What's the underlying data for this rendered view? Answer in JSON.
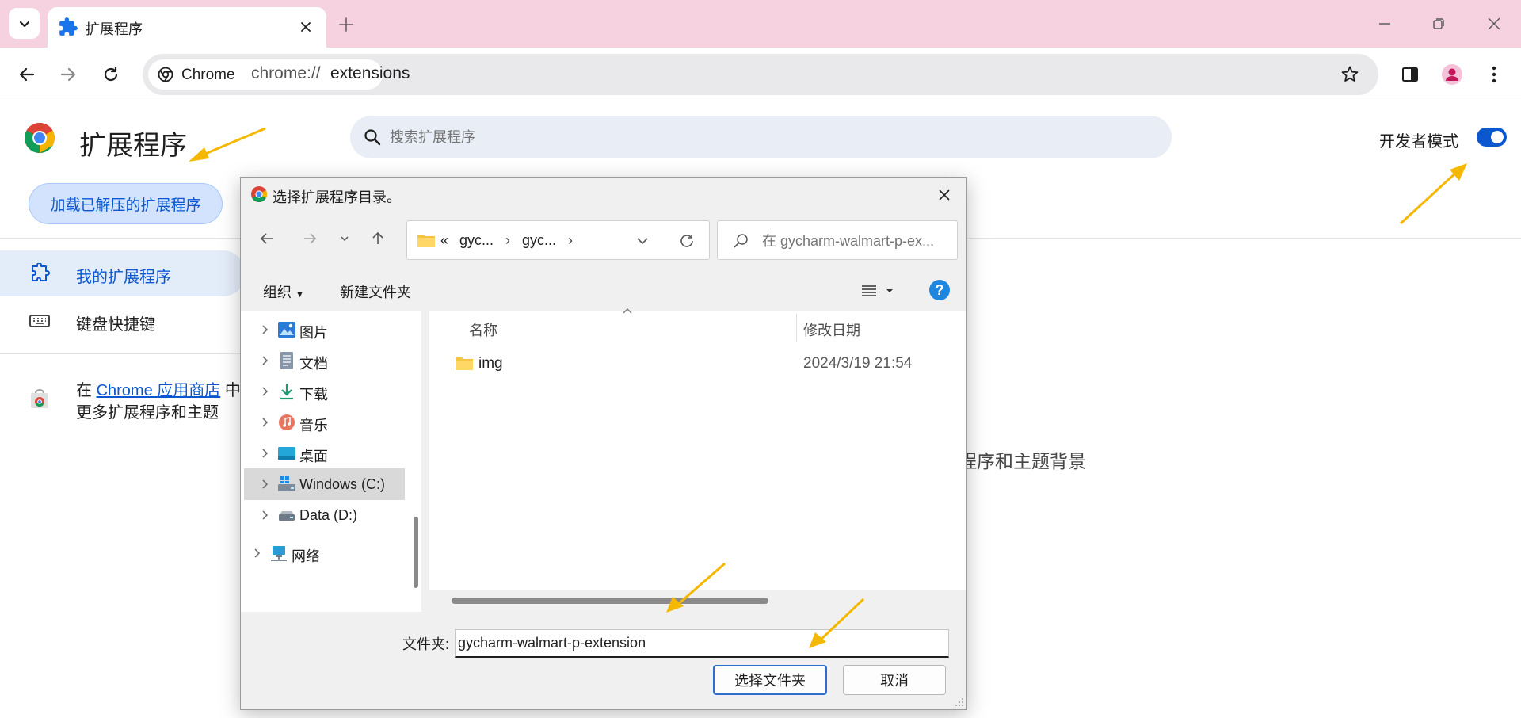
{
  "browser": {
    "tab": {
      "title": "扩展程序"
    },
    "omnibox": {
      "chip_label": "Chrome",
      "url_scheme": "chrome://",
      "url_host": "extensions"
    }
  },
  "page": {
    "title": "扩展程序",
    "search_placeholder": "搜索扩展程序",
    "dev_mode_label": "开发者模式",
    "dev_mode_on": true,
    "load_unpacked_label": "加载已解压的扩展程序",
    "sidebar": {
      "items": [
        {
          "label": "我的扩展程序",
          "icon": "extension-icon",
          "active": true
        },
        {
          "label": "键盘快捷键",
          "icon": "keyboard-icon",
          "active": false
        }
      ],
      "store_prefix": "在 ",
      "store_link": "Chrome 应用商店",
      "store_suffix": " 中",
      "store_line2": "更多扩展程序和主题"
    },
    "background_text": "程序和主题背景"
  },
  "dialog": {
    "title": "选择扩展程序目录。",
    "path_prefix": "«",
    "path_crumbs": [
      "gyc...",
      "gyc..."
    ],
    "path_sep": "›",
    "search_placeholder": "在 gycharm-walmart-p-ex...",
    "organize_label": "组织",
    "new_folder_label": "新建文件夹",
    "help_label": "?",
    "tree": [
      {
        "label": "图片",
        "icon": "pictures-icon"
      },
      {
        "label": "文档",
        "icon": "documents-icon"
      },
      {
        "label": "下载",
        "icon": "downloads-icon"
      },
      {
        "label": "音乐",
        "icon": "music-icon"
      },
      {
        "label": "桌面",
        "icon": "desktop-icon"
      },
      {
        "label": "Windows (C:)",
        "icon": "windows-drive-icon",
        "selected": true
      },
      {
        "label": "Data (D:)",
        "icon": "drive-icon"
      },
      {
        "label": "网络",
        "icon": "network-icon"
      }
    ],
    "columns": {
      "name": "名称",
      "modified": "修改日期"
    },
    "files": [
      {
        "name": "img",
        "modified": "2024/3/19 21:54",
        "icon": "folder-icon"
      }
    ],
    "folder_field_label": "文件夹:",
    "folder_field_value": "gycharm-walmart-p-extension",
    "select_button": "选择文件夹",
    "cancel_button": "取消"
  },
  "colors": {
    "tabstrip": "#f6d2e1",
    "accent": "#0b57d0",
    "annotation_arrow": "#f5b800"
  }
}
